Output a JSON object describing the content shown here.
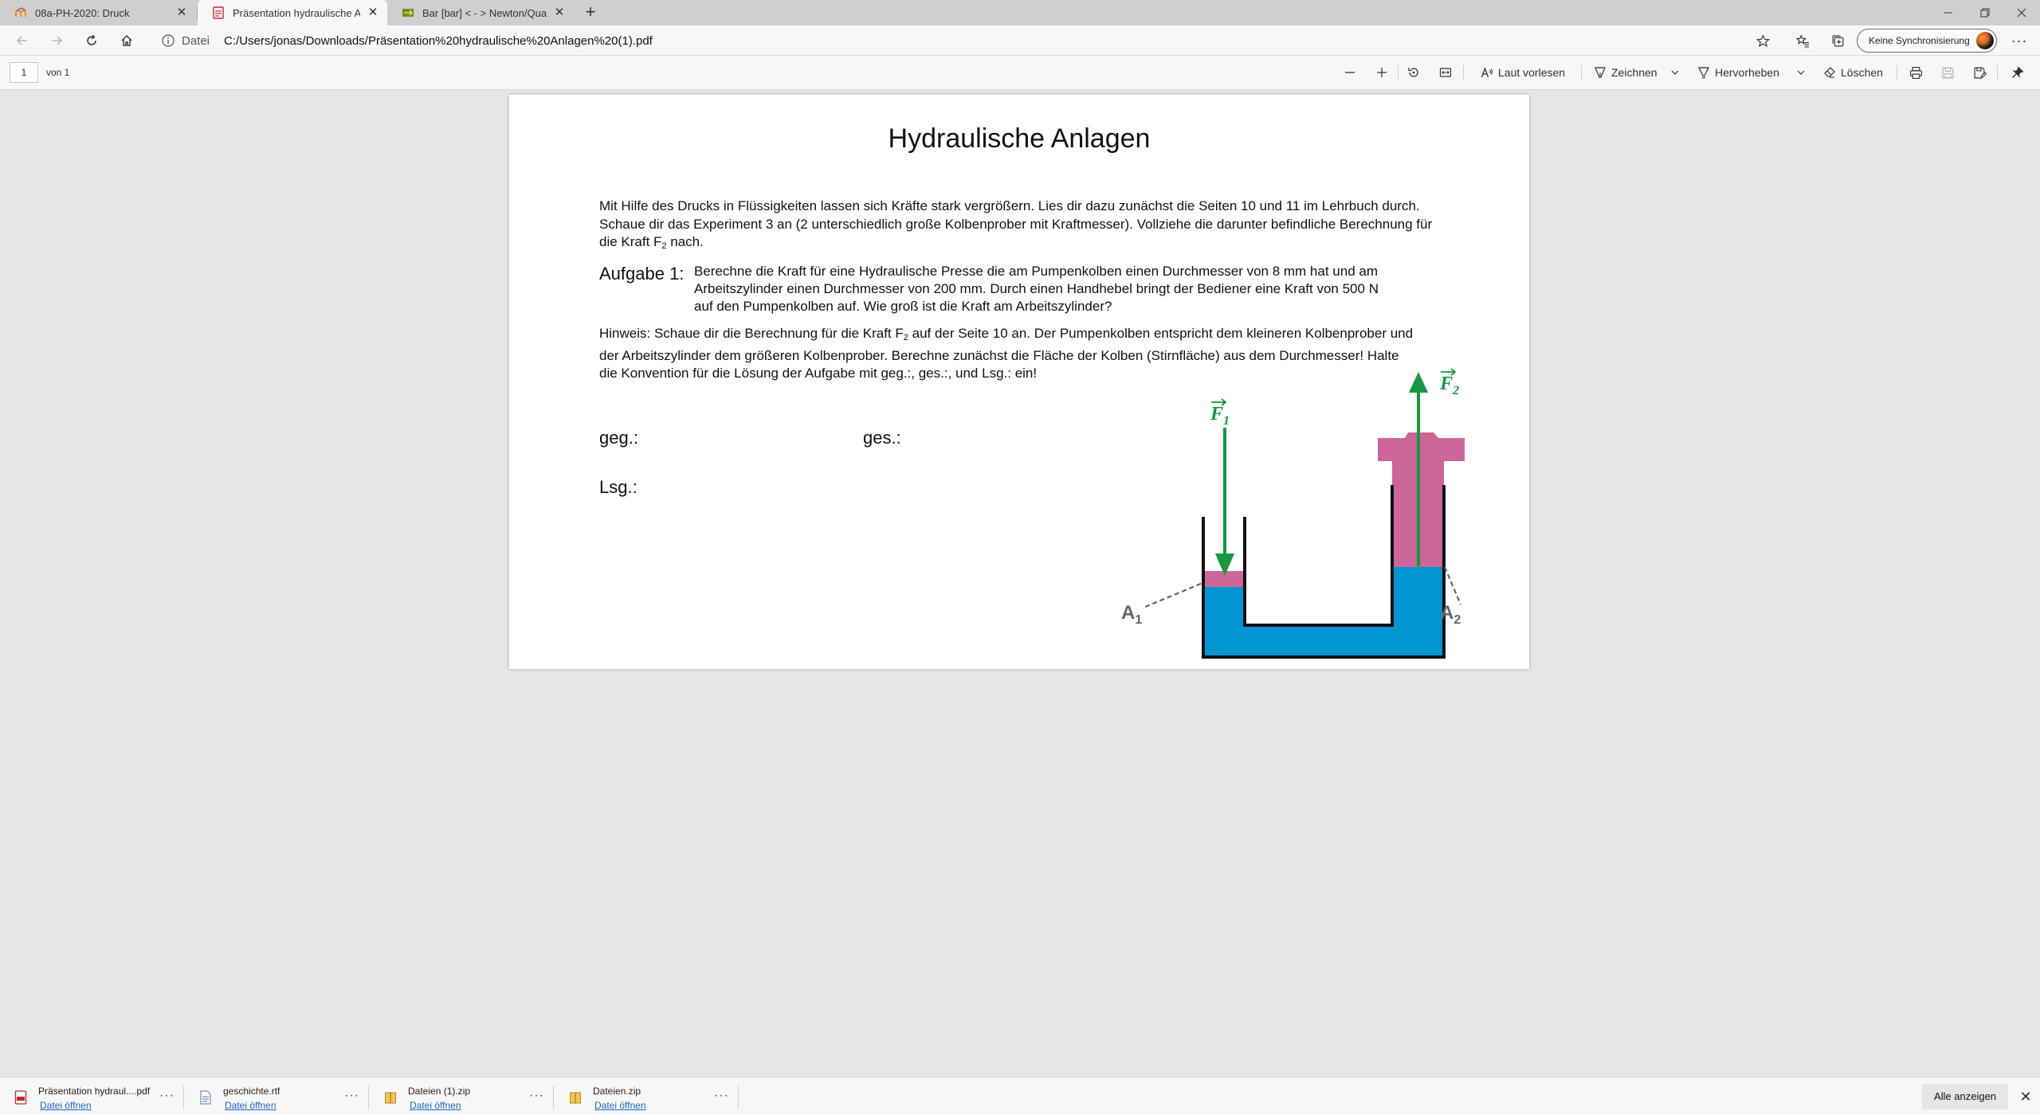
{
  "browser": {
    "tabs": [
      {
        "title": "08a-PH-2020: Druck",
        "close": "✕"
      },
      {
        "title": "Präsentation hydraulische Anlagen",
        "close": "✕"
      },
      {
        "title": "Bar [bar] < - > Newton/Quadratmeter",
        "close": "✕"
      }
    ],
    "newtab": "+",
    "address": {
      "scheme": "Datei",
      "url": "C:/Users/jonas/Downloads/Präsentation%20hydraulische%20Anlagen%20(1).pdf"
    },
    "sync_label": "Keine Synchronisierung",
    "menu": "···"
  },
  "pdf_toolbar": {
    "page_current": "1",
    "page_total": "von 1",
    "read_aloud": "Laut vorlesen",
    "draw": "Zeichnen",
    "highlight": "Hervorheben",
    "erase": "Löschen"
  },
  "document": {
    "title": "Hydraulische Anlagen",
    "intro_l1": "Mit Hilfe des Drucks in Flüssigkeiten lassen sich Kräfte stark vergrößern. Lies dir dazu zunächst die Seiten 10 und 11 im Lehrbuch durch.",
    "intro_l2": "Schaue dir das Experiment 3 an (2 unterschiedlich große Kolbenprober mit Kraftmesser). Vollziehe die darunter befindliche Berechnung für",
    "intro_l3a": "die Kraft F",
    "intro_l3_sub": "2",
    "intro_l3b": " nach.",
    "task_label": "Aufgabe 1:",
    "task_l1": "Berechne die Kraft für eine Hydraulische Presse die am Pumpenkolben einen Durchmesser von 8 mm hat und am",
    "task_l2": "Arbeitszylinder einen Durchmesser von 200 mm. Durch einen Handhebel bringt der Bediener eine Kraft von 500 N",
    "task_l3": "auf den Pumpenkolben auf. Wie groß ist die Kraft am Arbeitszylinder?",
    "hint_l1a": "Hinweis: Schaue dir die Berechnung für die Kraft F",
    "hint_l1_sub": "2",
    "hint_l1b": " auf der Seite 10 an. Der Pumpenkolben entspricht dem kleineren Kolbenprober und",
    "hint_l2": "der Arbeitszylinder dem größeren Kolbenprober. Berechne zunächst die Fläche der Kolben (Stirnfläche) aus dem Durchmesser! Halte",
    "hint_l3": "die Konvention für die Lösung der Aufgabe mit geg.:, ges.:, und Lsg.: ein!",
    "given": "geg.:",
    "sought": "ges.:",
    "solution": "Lsg.:",
    "figure": {
      "f1": "F",
      "f1_sub": "1",
      "f2": "F",
      "f2_sub": "2",
      "a1": "A",
      "a1_sub": "1",
      "a2": "A",
      "a2_sub": "2",
      "colors": {
        "piston": "#cc6699",
        "fluid": "#0096d2",
        "arrow": "#129a3c",
        "vessel": "#111111"
      }
    }
  },
  "downloads": [
    {
      "name": "Präsentation hydraul....pdf",
      "action": "Datei öffnen",
      "icon": "pdf-file-icon"
    },
    {
      "name": "geschichte.rtf",
      "action": "Datei öffnen",
      "icon": "rtf-file-icon"
    },
    {
      "name": "Dateien (1).zip",
      "action": "Datei öffnen",
      "icon": "zip-file-icon"
    },
    {
      "name": "Dateien.zip",
      "action": "Datei öffnen",
      "icon": "zip-file-icon"
    }
  ],
  "shelf": {
    "show_all": "Alle anzeigen",
    "close": "✕"
  }
}
